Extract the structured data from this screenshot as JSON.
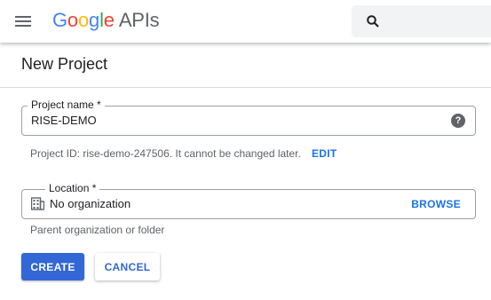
{
  "header": {
    "menu_icon": "hamburger-menu-icon",
    "logo": {
      "google_letters": [
        {
          "char": "G",
          "color": "#4285F4"
        },
        {
          "char": "o",
          "color": "#EA4335"
        },
        {
          "char": "o",
          "color": "#FBBC05"
        },
        {
          "char": "g",
          "color": "#4285F4"
        },
        {
          "char": "l",
          "color": "#34A853"
        },
        {
          "char": "e",
          "color": "#EA4335"
        }
      ],
      "suffix": "APIs"
    },
    "search": {
      "icon": "search-icon",
      "placeholder": "",
      "value": ""
    }
  },
  "page": {
    "title": "New Project"
  },
  "form": {
    "project_name": {
      "label": "Project name *",
      "value": "RISE-DEMO",
      "help_icon": "help-icon"
    },
    "project_id_hint": "Project ID: rise-demo-247506. It cannot be changed later.",
    "edit_label": "EDIT",
    "location": {
      "label": "Location *",
      "icon": "organization-building-icon",
      "value": "No organization",
      "browse_label": "BROWSE"
    },
    "location_hint": "Parent organization or folder"
  },
  "actions": {
    "create_label": "CREATE",
    "cancel_label": "CANCEL"
  },
  "colors": {
    "primary": "#3367d6",
    "link": "#1a73e8",
    "border": "#9aa0a6",
    "search_bg": "#f1f3f4"
  }
}
